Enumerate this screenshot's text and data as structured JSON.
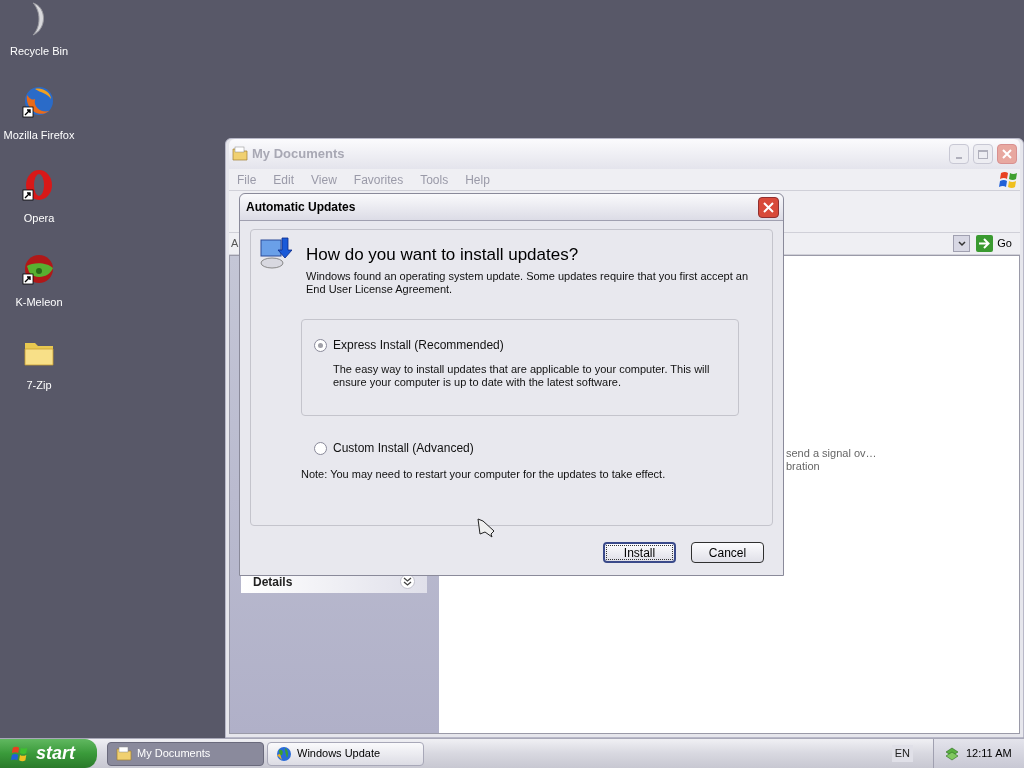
{
  "desktop_icons": [
    {
      "label": "Recycle Bin",
      "kind": "moon",
      "shortcut": false
    },
    {
      "label": "Mozilla Firefox",
      "kind": "firefox",
      "shortcut": true
    },
    {
      "label": "Opera",
      "kind": "opera",
      "shortcut": true
    },
    {
      "label": "K-Meleon",
      "kind": "kmeleon",
      "shortcut": true
    },
    {
      "label": "7-Zip",
      "kind": "folder",
      "shortcut": false
    }
  ],
  "explorer": {
    "title": "My Documents",
    "active": false,
    "menu": [
      "File",
      "Edit",
      "View",
      "Favorites",
      "Tools",
      "Help"
    ],
    "address_label": "A",
    "go_label": "Go",
    "details": {
      "title": "Details",
      "expanded": false
    },
    "content_lines": [
      "send a signal ov…",
      "bration"
    ]
  },
  "dialog": {
    "title": "Automatic Updates",
    "heading": "How do you want to install updates?",
    "description": "Windows found an operating system update. Some updates require that you first accept an End User License Agreement.",
    "options": [
      {
        "label": "Express Install (Recommended)",
        "description": "The easy way to install updates that are applicable to your computer. This will ensure your computer is up to date with the latest software.",
        "selected": true
      },
      {
        "label": "Custom Install (Advanced)",
        "selected": false
      }
    ],
    "note": "Note: You may need to restart your computer for the updates to take effect.",
    "buttons": [
      {
        "label": "Install",
        "default": true
      },
      {
        "label": "Cancel",
        "default": false
      }
    ]
  },
  "taskbar": {
    "start": "start",
    "tasks": [
      {
        "label": "My Documents",
        "kind": "folder",
        "selected": true
      },
      {
        "label": "Windows Update",
        "kind": "globe",
        "selected": false
      }
    ],
    "language": "EN",
    "clock": "12:11 AM"
  }
}
